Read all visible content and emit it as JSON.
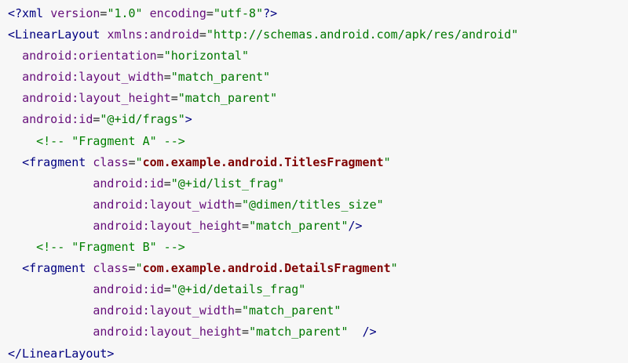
{
  "code": {
    "lines": [
      {
        "indent": 0,
        "tokens": [
          {
            "t": "tag",
            "v": "<?xml "
          },
          {
            "t": "attr",
            "v": "version"
          },
          {
            "t": "punc",
            "v": "="
          },
          {
            "t": "str",
            "v": "\"1.0\""
          },
          {
            "t": "punc",
            "v": " "
          },
          {
            "t": "attr",
            "v": "encoding"
          },
          {
            "t": "punc",
            "v": "="
          },
          {
            "t": "str",
            "v": "\"utf-8\""
          },
          {
            "t": "tag",
            "v": "?>"
          }
        ]
      },
      {
        "indent": 0,
        "tokens": [
          {
            "t": "tag",
            "v": "<LinearLayout "
          },
          {
            "t": "attr",
            "v": "xmlns:android"
          },
          {
            "t": "punc",
            "v": "="
          },
          {
            "t": "str",
            "v": "\"http://schemas.android.com/apk/res/android\""
          }
        ]
      },
      {
        "indent": 1,
        "tokens": [
          {
            "t": "attr",
            "v": "android:orientation"
          },
          {
            "t": "punc",
            "v": "="
          },
          {
            "t": "str",
            "v": "\"horizontal\""
          }
        ]
      },
      {
        "indent": 1,
        "tokens": [
          {
            "t": "attr",
            "v": "android:layout_width"
          },
          {
            "t": "punc",
            "v": "="
          },
          {
            "t": "str",
            "v": "\"match_parent\""
          }
        ]
      },
      {
        "indent": 1,
        "tokens": [
          {
            "t": "attr",
            "v": "android:layout_height"
          },
          {
            "t": "punc",
            "v": "="
          },
          {
            "t": "str",
            "v": "\"match_parent\""
          }
        ]
      },
      {
        "indent": 1,
        "tokens": [
          {
            "t": "attr",
            "v": "android:id"
          },
          {
            "t": "punc",
            "v": "="
          },
          {
            "t": "str",
            "v": "\"@+id/frags\""
          },
          {
            "t": "tag",
            "v": ">"
          }
        ]
      },
      {
        "indent": 2,
        "tokens": [
          {
            "t": "cmt",
            "v": "<!-- \"Fragment A\" -->"
          }
        ]
      },
      {
        "indent": 1,
        "tokens": [
          {
            "t": "tag",
            "v": "<fragment "
          },
          {
            "t": "attr",
            "v": "class"
          },
          {
            "t": "punc",
            "v": "="
          },
          {
            "t": "str",
            "v": "\""
          },
          {
            "t": "cls",
            "v": "com.example.android.TitlesFragment"
          },
          {
            "t": "str",
            "v": "\""
          }
        ]
      },
      {
        "indent": 6,
        "tokens": [
          {
            "t": "attr",
            "v": "android:id"
          },
          {
            "t": "punc",
            "v": "="
          },
          {
            "t": "str",
            "v": "\"@+id/list_frag\""
          }
        ]
      },
      {
        "indent": 6,
        "tokens": [
          {
            "t": "attr",
            "v": "android:layout_width"
          },
          {
            "t": "punc",
            "v": "="
          },
          {
            "t": "str",
            "v": "\"@dimen/titles_size\""
          }
        ]
      },
      {
        "indent": 6,
        "tokens": [
          {
            "t": "attr",
            "v": "android:layout_height"
          },
          {
            "t": "punc",
            "v": "="
          },
          {
            "t": "str",
            "v": "\"match_parent\""
          },
          {
            "t": "tag",
            "v": "/>"
          }
        ]
      },
      {
        "indent": 2,
        "tokens": [
          {
            "t": "cmt",
            "v": "<!-- \"Fragment B\" -->"
          }
        ]
      },
      {
        "indent": 1,
        "tokens": [
          {
            "t": "tag",
            "v": "<fragment "
          },
          {
            "t": "attr",
            "v": "class"
          },
          {
            "t": "punc",
            "v": "="
          },
          {
            "t": "str",
            "v": "\""
          },
          {
            "t": "cls",
            "v": "com.example.android.DetailsFragment"
          },
          {
            "t": "str",
            "v": "\""
          }
        ]
      },
      {
        "indent": 6,
        "tokens": [
          {
            "t": "attr",
            "v": "android:id"
          },
          {
            "t": "punc",
            "v": "="
          },
          {
            "t": "str",
            "v": "\"@+id/details_frag\""
          }
        ]
      },
      {
        "indent": 6,
        "tokens": [
          {
            "t": "attr",
            "v": "android:layout_width"
          },
          {
            "t": "punc",
            "v": "="
          },
          {
            "t": "str",
            "v": "\"match_parent\""
          }
        ]
      },
      {
        "indent": 6,
        "tokens": [
          {
            "t": "attr",
            "v": "android:layout_height"
          },
          {
            "t": "punc",
            "v": "="
          },
          {
            "t": "str",
            "v": "\"match_parent\""
          },
          {
            "t": "punc",
            "v": "  "
          },
          {
            "t": "tag",
            "v": "/>"
          }
        ]
      },
      {
        "indent": 0,
        "tokens": [
          {
            "t": "tag",
            "v": "</LinearLayout>"
          }
        ]
      }
    ]
  },
  "colors": {
    "background": "#f7f7f7",
    "tag": "#000080",
    "attribute": "#660e7a",
    "string": "#007700",
    "comment": "#008000",
    "class_name": "#7f0000"
  }
}
